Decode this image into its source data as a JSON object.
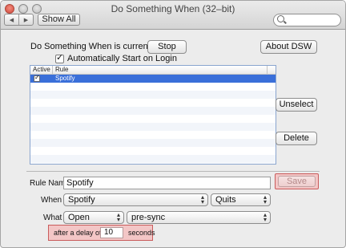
{
  "window": {
    "title": "Do Something When (32–bit)",
    "nav_back_icon": "triangle-left",
    "nav_forward_icon": "triangle-right",
    "show_all_label": "Show All",
    "search": {
      "placeholder": "",
      "icon": "magnifier"
    }
  },
  "status": {
    "label": "Do Something When is currently ON",
    "stop_label": "Stop",
    "about_label": "About DSW",
    "auto_start_label": "Automatically Start on Login",
    "auto_start_checked": true
  },
  "table": {
    "columns": [
      "Active",
      "Rule"
    ],
    "rows": [
      {
        "active": true,
        "rule": "Spotify",
        "selected": true
      }
    ],
    "selection_color": "#3a6fd9"
  },
  "side_buttons": {
    "unselect_label": "Unselect",
    "delete_label": "Delete"
  },
  "editor": {
    "rule_name_label": "Rule Name",
    "rule_name_value": "Spotify",
    "save_label": "Save",
    "when_label": "When",
    "when_app": "Spotify",
    "when_event": "Quits",
    "what_label": "What",
    "what_action": "Open",
    "what_target": "pre-sync",
    "delay_prefix": "after a delay of",
    "delay_value": "10",
    "delay_suffix": "seconds",
    "highlight_color": "#f3c6c6"
  }
}
